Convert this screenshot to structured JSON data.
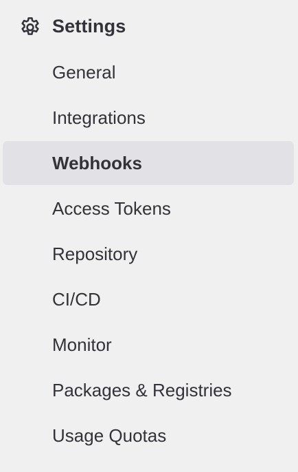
{
  "section": {
    "icon": "gear-icon",
    "title": "Settings"
  },
  "items": [
    {
      "label": "General"
    },
    {
      "label": "Integrations"
    },
    {
      "label": "Webhooks",
      "active": true
    },
    {
      "label": "Access Tokens"
    },
    {
      "label": "Repository"
    },
    {
      "label": "CI/CD"
    },
    {
      "label": "Monitor"
    },
    {
      "label": "Packages & Registries"
    },
    {
      "label": "Usage Quotas"
    }
  ],
  "colors": {
    "background": "#f0f0f0",
    "active_background": "#e1e1e6",
    "text": "#333238"
  }
}
